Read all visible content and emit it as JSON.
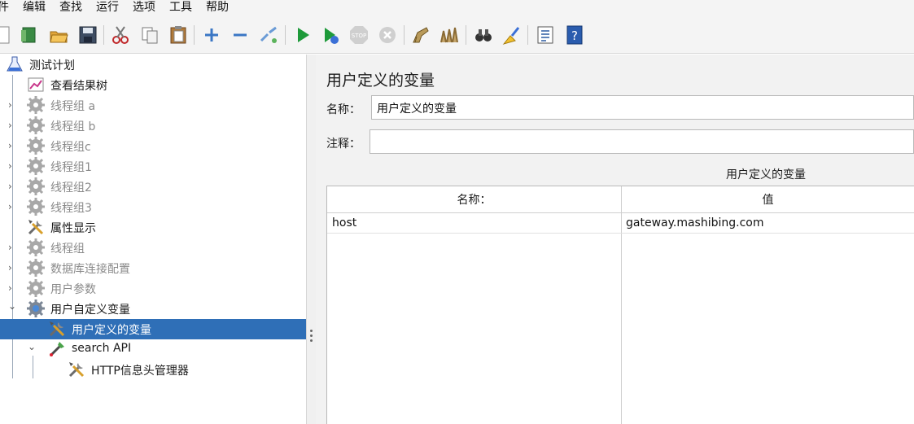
{
  "menu": [
    "件",
    "编辑",
    "查找",
    "运行",
    "选项",
    "工具",
    "帮助"
  ],
  "toolbar": {
    "icons": [
      "new-icon",
      "templates-icon",
      "open-icon",
      "save-icon",
      "cut-icon",
      "copy-icon",
      "paste-icon",
      "expand-icon",
      "collapse-icon",
      "toggle-icon",
      "start-icon",
      "start-no-pause-icon",
      "stop-icon",
      "shutdown-icon",
      "clear-icon",
      "clear-all-icon",
      "search-icon",
      "reset-search-icon",
      "function-helper-icon",
      "help-icon"
    ]
  },
  "tree": {
    "items": [
      {
        "label": "测试计划",
        "dim": false,
        "icon": "test-plan-icon",
        "chevron": ""
      },
      {
        "label": "查看结果树",
        "dim": false,
        "icon": "results-tree-icon",
        "chevron": ""
      },
      {
        "label": "线程组 a",
        "dim": true,
        "icon": "gear-icon",
        "chevron": "›"
      },
      {
        "label": "线程组 b",
        "dim": true,
        "icon": "gear-icon",
        "chevron": "›"
      },
      {
        "label": "线程组c",
        "dim": true,
        "icon": "gear-icon",
        "chevron": "›"
      },
      {
        "label": "线程组1",
        "dim": true,
        "icon": "gear-icon",
        "chevron": "›"
      },
      {
        "label": "线程组2",
        "dim": true,
        "icon": "gear-icon",
        "chevron": "›"
      },
      {
        "label": "线程组3",
        "dim": true,
        "icon": "gear-icon",
        "chevron": "›"
      },
      {
        "label": "属性显示",
        "dim": false,
        "icon": "tools-icon",
        "chevron": ""
      },
      {
        "label": "线程组",
        "dim": true,
        "icon": "gear-icon",
        "chevron": "›"
      },
      {
        "label": "数据库连接配置",
        "dim": true,
        "icon": "gear-icon",
        "chevron": "›"
      },
      {
        "label": "用户参数",
        "dim": true,
        "icon": "gear-icon",
        "chevron": "›"
      },
      {
        "label": "用户自定义变量",
        "dim": false,
        "icon": "gear-icon",
        "chevron": "⌄"
      },
      {
        "label": "用户定义的变量",
        "dim": false,
        "icon": "tools-icon",
        "chevron": "",
        "selected": true
      },
      {
        "label": "search API",
        "dim": false,
        "icon": "sampler-icon",
        "chevron": "⌄"
      },
      {
        "label": "HTTP信息头管理器",
        "dim": false,
        "icon": "tools-icon",
        "chevron": ""
      }
    ]
  },
  "panel": {
    "title": "用户定义的变量",
    "name_label": "名称：",
    "name_value": "用户定义的变量",
    "comment_label": "注释：",
    "comment_value": "",
    "grid_title": "用户定义的变量",
    "columns": [
      "名称：",
      "值"
    ],
    "rows": [
      [
        "host",
        "gateway.mashibing.com"
      ]
    ]
  }
}
